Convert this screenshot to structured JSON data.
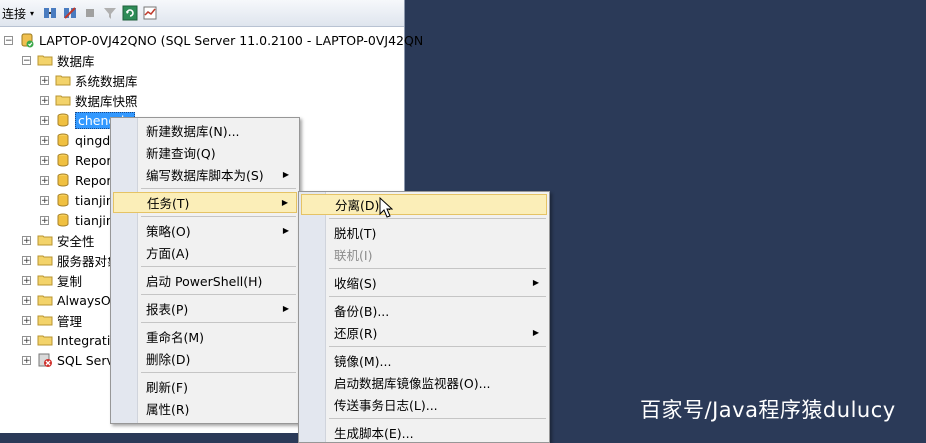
{
  "toolbar": {
    "connect_label": "连接",
    "dropdown_glyph": "▾"
  },
  "tree": {
    "server": "LAPTOP-0VJ42QNO (SQL Server 11.0.2100 - LAPTOP-0VJ42QN",
    "databases": "数据库",
    "system_dbs": "系统数据库",
    "snapshots": "数据库快照",
    "db_items": [
      "chengdu",
      "qingd",
      "Repor",
      "Repor",
      "tianjin",
      "tianjin"
    ],
    "security": "安全性",
    "server_objects": "服务器对象",
    "replication": "复制",
    "alwayson": "AlwaysOn",
    "management": "管理",
    "integration": "Integration",
    "agent": "SQL Serv",
    "expand_minus": "−",
    "expand_plus": "+"
  },
  "menu1": {
    "items": [
      "新建数据库(N)...",
      "新建查询(Q)",
      "编写数据库脚本为(S)",
      "任务(T)",
      "策略(O)",
      "方面(A)",
      "启动 PowerShell(H)",
      "报表(P)",
      "重命名(M)",
      "删除(D)",
      "刷新(F)",
      "属性(R)"
    ],
    "submenu_glyph": "▶"
  },
  "menu2": {
    "items": [
      "分离(D)...",
      "脱机(T)",
      "联机(I)",
      "收缩(S)",
      "备份(B)...",
      "还原(R)",
      "镜像(M)...",
      "启动数据库镜像监视器(O)...",
      "传送事务日志(L)...",
      "生成脚本(E)..."
    ]
  },
  "watermark": "百家号/Java程序猿dulucy",
  "colors": {
    "background": "#2b3a58",
    "highlight": "#fbeeb8",
    "selection": "#3399ff"
  }
}
